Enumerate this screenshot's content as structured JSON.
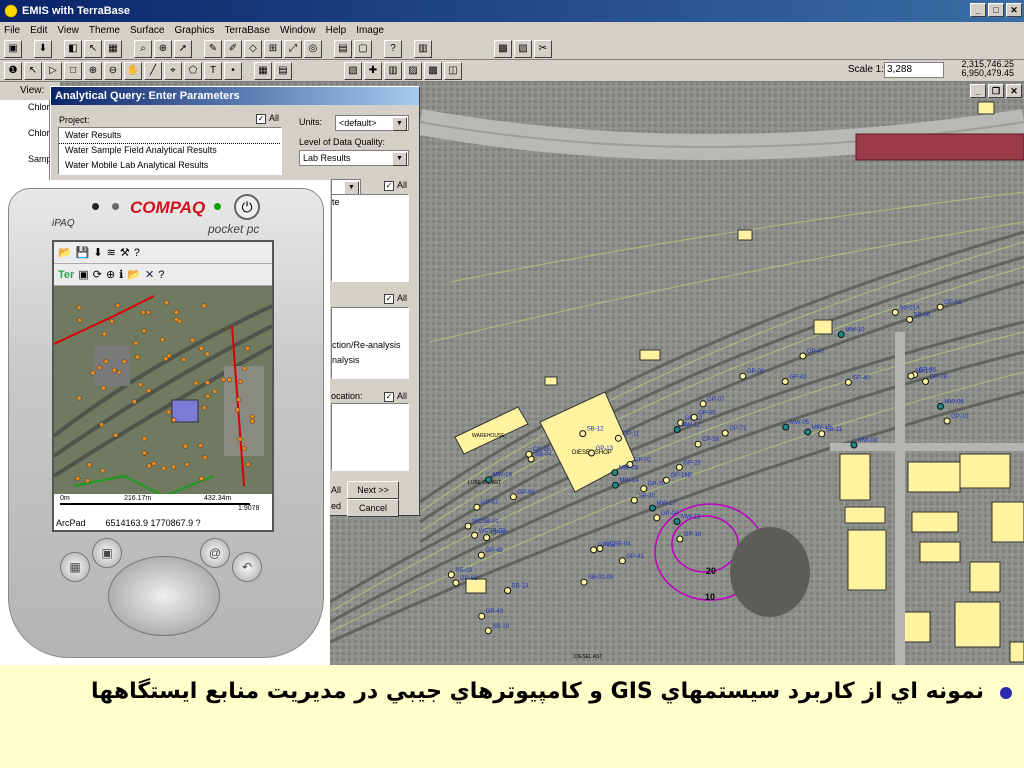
{
  "window": {
    "title": "EMIS with TerraBase",
    "buttons": [
      "_",
      "□",
      "✕"
    ]
  },
  "menu": [
    "File",
    "Edit",
    "View",
    "Theme",
    "Surface",
    "Graphics",
    "TerraBase",
    "Window",
    "Help",
    "Image"
  ],
  "status_bar": {
    "scale_label": "Scale 1:",
    "scale_value": "3,288",
    "coord_x": "2,315,746.25",
    "coord_y": "6,950,479.45"
  },
  "view_tab": "View:",
  "legend_items": [
    "Chlor",
    "Chlor",
    "Samp"
  ],
  "dialog": {
    "title": "Analytical Query: Enter Parameters",
    "project_label": "Project:",
    "all_label": "All",
    "projects": [
      "Water Results",
      "Water Sample Field Analytical Results",
      "Water Mobile Lab Analytical Results"
    ],
    "units_label": "Units:",
    "units_value": "<default>",
    "quality_label": "Level of Data Quality:",
    "quality_value": "Lab Results",
    "partial_te": "te",
    "partial_reanalysis": "ction/Re-analysis",
    "partial_analysis": "nalysis",
    "partial_location": "ocation:",
    "partial_all": "All",
    "partial_ed": "ed",
    "next_button": "Next >>",
    "cancel_button": "Cancel"
  },
  "pocketpc": {
    "brand": "COMPAQ",
    "model": "iPAQ",
    "os": "pocket pc",
    "app_name": "ArcPad",
    "coordinates": "6514163.9 1770867.9 ?",
    "scale_0": "0m",
    "scale_1": "216.17m",
    "scale_2": "432.34m",
    "scale_ratio": "1:9078",
    "toolbar_ter": "Ter"
  },
  "map_labels": {
    "diesel_shop": "DIESEL SHOP",
    "warehouse": "WAREHOUSE",
    "lube_oil": "LUBE OIL AST",
    "diesel_ast": "DIESEL AST",
    "contour_20": "20",
    "contour_10": "10",
    "points": [
      "GP-09",
      "GP-23",
      "GP-36",
      "GP-08",
      "GP-49",
      "GP-47",
      "GP-07",
      "GP-10",
      "GP-16",
      "GP-16B",
      "GP-13",
      "GP-12",
      "GP-11",
      "GP-02",
      "GP-01",
      "GP-05",
      "GP-04",
      "GP-08",
      "MW-16",
      "MW-15",
      "MW-14",
      "MW-13",
      "MW-12",
      "MW-10",
      "MW-08",
      "MW-06",
      "MW-05",
      "MW-03",
      "MW-17",
      "SB-02-09",
      "SB-30",
      "SB-19",
      "SB-17",
      "SB-13",
      "SB-12",
      "SB-11",
      "SB-06",
      "SB-04",
      "SB-03",
      "SB-01A",
      "WCSB-01",
      "WCSB-03",
      "WCSB-04",
      "CP-25",
      "CP-50",
      "CP-58",
      "GP-40",
      "GP-41",
      "GP-42",
      "GP-43",
      "GP-57",
      "GP-62",
      "GP-70",
      "GP-71",
      "GP-79"
    ]
  },
  "caption": {
    "text": "نمونه اي از كاربرد سيستمهاي GIS و كامپيوترهاي جيبي در مديريت منابع ايستگاهها"
  },
  "colors": {
    "title_bar": "#0a246a",
    "caption_bg": "#ffffcc",
    "building_fill": "#fff3a0",
    "point_blue": "#1a2fbf",
    "contour_magenta": "#c000c0",
    "compaq_red": "#d0101a"
  }
}
